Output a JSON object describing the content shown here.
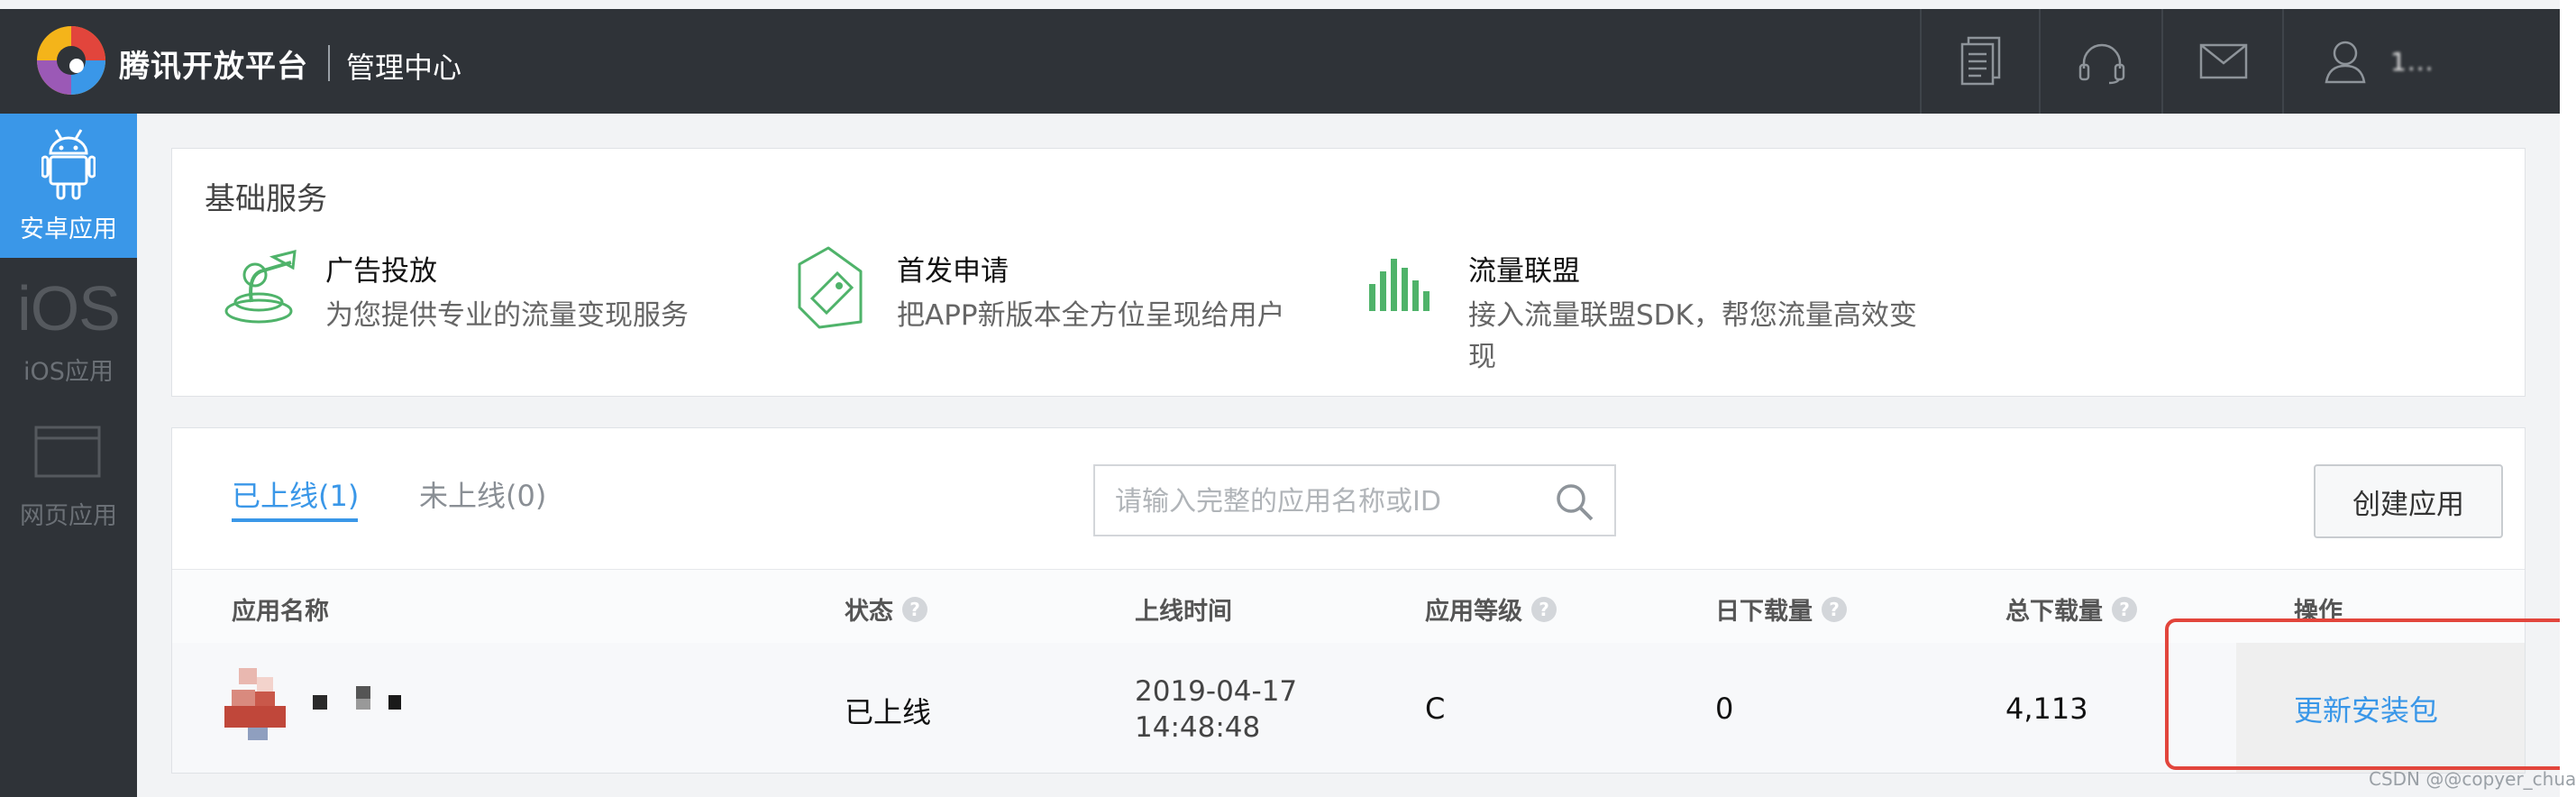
{
  "header": {
    "brand": "腾讯开放平台",
    "console": "管理中心",
    "username": "1... "
  },
  "sidebar": {
    "items": [
      {
        "label": "安卓应用",
        "icon": "android-icon",
        "active": true
      },
      {
        "label": "iOS应用",
        "icon": "ios-icon",
        "icon_text": "iOS",
        "active": false
      },
      {
        "label": "网页应用",
        "icon": "webpage-icon",
        "active": false
      }
    ]
  },
  "services": {
    "title": "基础服务",
    "items": [
      {
        "name": "广告投放",
        "desc": "为您提供专业的流量变现服务",
        "icon": "ad-placement-icon"
      },
      {
        "name": "首发申请",
        "desc": "把APP新版本全方位呈现给用户",
        "icon": "tag-icon"
      },
      {
        "name": "流量联盟",
        "desc": "接入流量联盟SDK，帮您流量高效变现",
        "icon": "bar-chart-icon"
      }
    ]
  },
  "app_list": {
    "tabs": [
      {
        "label": "已上线(1)",
        "active": true
      },
      {
        "label": "未上线(0)",
        "active": false
      }
    ],
    "search": {
      "placeholder": "请输入完整的应用名称或ID",
      "value": ""
    },
    "create_button": "创建应用",
    "columns": [
      {
        "label": "应用名称",
        "help": false
      },
      {
        "label": "状态",
        "help": true
      },
      {
        "label": "上线时间",
        "help": false
      },
      {
        "label": "应用等级",
        "help": true
      },
      {
        "label": "日下载量",
        "help": true
      },
      {
        "label": "总下载量",
        "help": true
      },
      {
        "label": "操作",
        "help": false
      }
    ],
    "rows": [
      {
        "status": "已上线",
        "date": "2019-04-17",
        "time": "14:48:48",
        "level": "C",
        "daily_downloads": "0",
        "total_downloads": "4,113",
        "action": "更新安装包"
      }
    ]
  },
  "watermark": "CSDN @@copyer_chuan",
  "colors": {
    "accent": "#3a97e8",
    "topbar": "#2f3338",
    "highlight": "#e2453c",
    "service_icon": "#4fb36a"
  }
}
